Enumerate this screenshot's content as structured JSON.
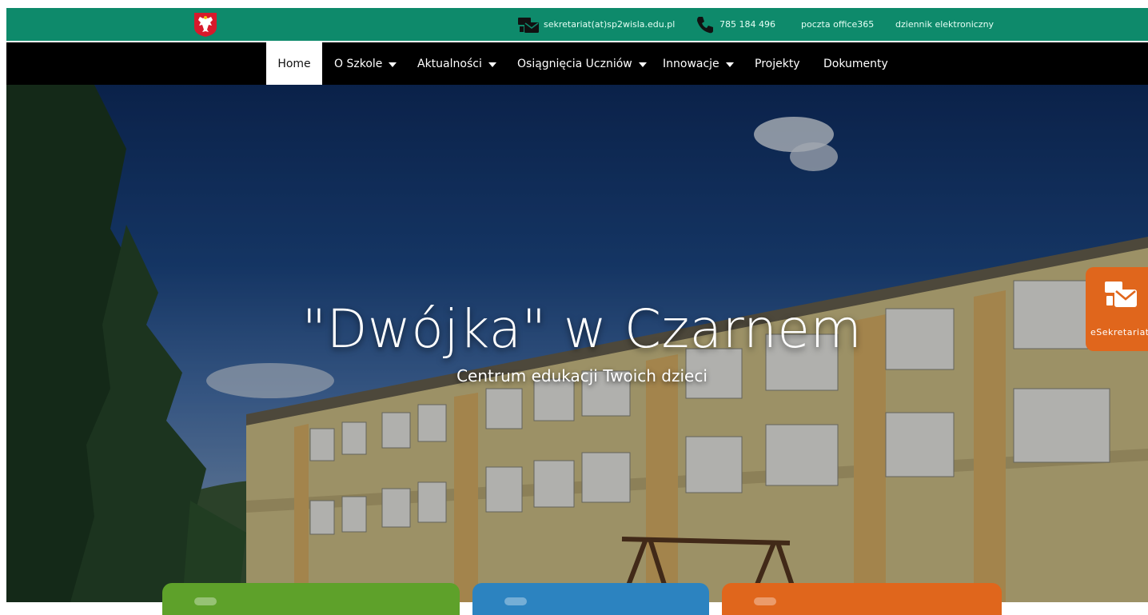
{
  "topbar": {
    "email": "sekretariat(at)sp2wisla.edu.pl",
    "phone": "785 184 496",
    "link_mail": "poczta office365",
    "link_diary": "dziennik elektroniczny",
    "emblem_icon": "polish-eagle-emblem-icon",
    "email_icon": "envelope-icon",
    "phone_icon": "phone-icon"
  },
  "nav": {
    "items": [
      {
        "label": "Home",
        "active": true,
        "dropdown": false
      },
      {
        "label": "O Szkole",
        "active": false,
        "dropdown": true
      },
      {
        "label": "Aktualności",
        "active": false,
        "dropdown": true
      },
      {
        "label": "Osiągnięcia Uczniów",
        "active": false,
        "dropdown": true
      },
      {
        "label": "Innowacje",
        "active": false,
        "dropdown": true
      },
      {
        "label": "Projekty",
        "active": false,
        "dropdown": false
      },
      {
        "label": "Dokumenty",
        "active": false,
        "dropdown": false
      }
    ]
  },
  "hero": {
    "title": "\"Dwójka\" w Czarnem",
    "subtitle": "Centrum edukacji Twoich dzieci"
  },
  "side_tab": {
    "label": "eSekretariat",
    "icon": "envelope-icon"
  },
  "colors": {
    "topbar": "#0e8a6b",
    "navbar": "#000000",
    "accent_orange": "#e0661c",
    "card_green": "#5ea12a",
    "card_blue": "#2c83c0"
  }
}
